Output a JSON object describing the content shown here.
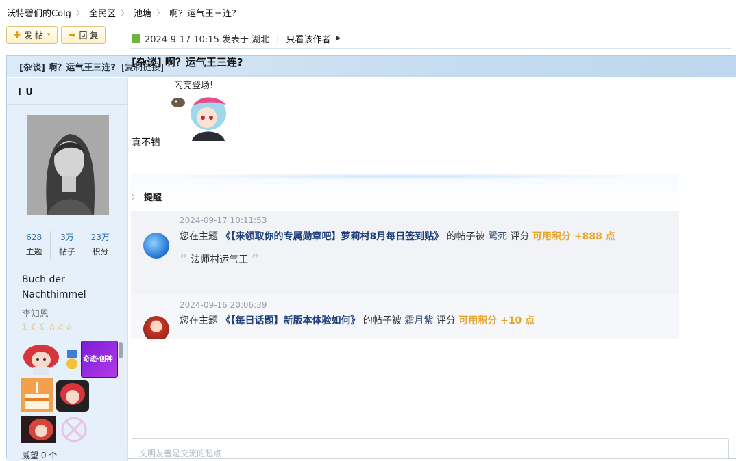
{
  "breadcrumb": {
    "items": [
      "沃特碧们的Colg",
      "全民区",
      "池塘",
      "啊？运气王三连?"
    ],
    "sep": "〉"
  },
  "actions": {
    "post_label": "发 帖",
    "reply_label": "回 复"
  },
  "thread": {
    "title": "[杂谈] 啊？运气王三连?",
    "copy_link": "[复制链接]"
  },
  "author": {
    "name": "I U",
    "stats": [
      {
        "value": "628",
        "label": "主题"
      },
      {
        "value": "3万",
        "label": "帖子"
      },
      {
        "value": "23万",
        "label": "积分"
      }
    ],
    "signature": "Buch der Nachthimmel",
    "group": "李知恩",
    "stars": "☾☾☾☆☆☆",
    "medal_text": "奇迹·创神",
    "footer": "威望    0 个"
  },
  "post": {
    "meta_date": "2024-9-17 10:15 发表于 湖北",
    "only_author": "只看该作者",
    "title": "[杂谈] 啊？运气王三连?",
    "sticker_caption": "闪亮登场!",
    "body_text": "真不错"
  },
  "screenshot": {
    "header": "提醒",
    "notices": [
      {
        "date": "2024-09-17 10:11:53",
        "prefix": "您在主题",
        "topic": "《【来领取你的专属勋章吧】萝莉村8月每日签到贴》",
        "mid": "的帖子被",
        "user": "鹭死",
        "action": "评分",
        "points": "可用积分 +888 点",
        "quote": "法师村运气王"
      },
      {
        "date": "2024-09-16 20:06:39",
        "prefix": "您在主题",
        "topic": "《【每日话题】新版本体验如何》",
        "mid": "的帖子被",
        "user": "霜月紫",
        "action": "评分",
        "points": "可用积分 +10 点"
      }
    ]
  },
  "reply_box": {
    "placeholder": "文明友善是交流的起点"
  },
  "colors": {
    "accent": "#2d6ca6",
    "title_band": "#c6dcf0",
    "points": "#e6a42b"
  }
}
